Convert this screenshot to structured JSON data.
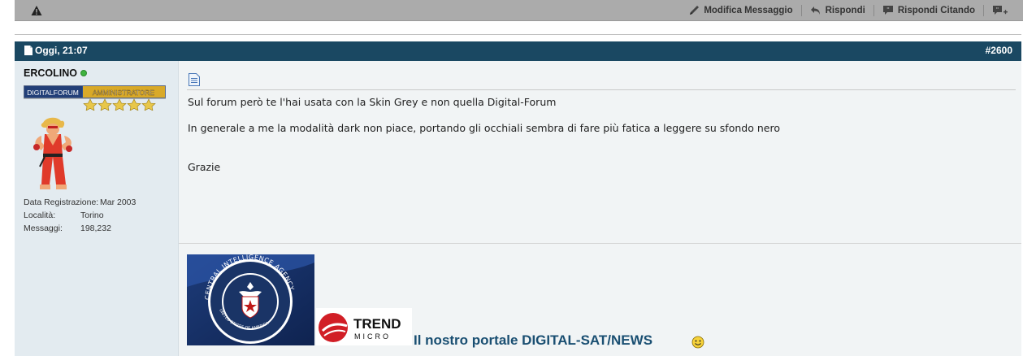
{
  "toolbar": {
    "modify_label": "Modifica Messaggio",
    "reply_label": "Rispondi",
    "quote_label": "Rispondi Citando",
    "multiquote_icon": "multiquote-icon",
    "warn_icon": "warning-icon"
  },
  "post": {
    "date": "Oggi, 21:07",
    "number": "#2600",
    "header_color": "#1a4862"
  },
  "user": {
    "name": "ERCOLINO",
    "rank_left": "DIGITALFORUM",
    "rank_right": "AMMINISTRATORE",
    "fields": [
      {
        "label": "Data Registrazione:",
        "value": "Mar 2003"
      },
      {
        "label": "Località:",
        "value": "Torino"
      },
      {
        "label": "Messaggi:",
        "value": "198,232"
      }
    ]
  },
  "message": {
    "line1": "Sul forum però te l'hai usata con la Skin Grey e non quella Digital-Forum",
    "line2": "In generale a me la modalità dark non piace, portando gli occhiali sembra di fare più fatica a leggere su sfondo nero",
    "line3": "Grazie"
  },
  "signature": {
    "cia_seal_text": "CENTRAL INTELLIGENCE AGENCY",
    "cia_seal_bottom": "UNITED STATES OF AMERICA",
    "trend_brand": "TREND",
    "trend_sub": "MICRO",
    "link_text": "Il nostro portale DIGITAL-SAT/NEWS"
  }
}
